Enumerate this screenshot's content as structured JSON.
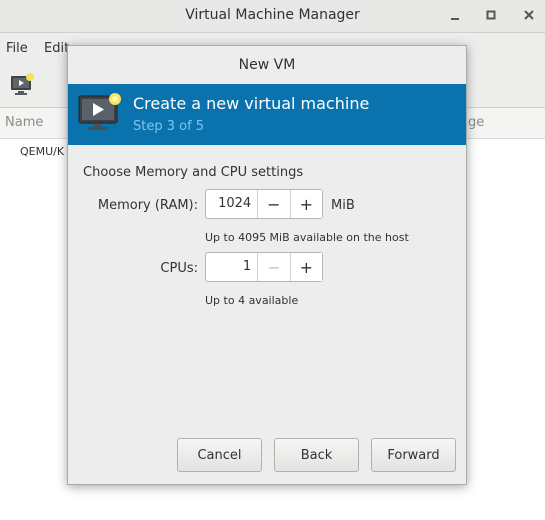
{
  "window": {
    "title": "Virtual Machine Manager",
    "controls": {
      "minimize": "_",
      "maximize": "□",
      "close": "×"
    }
  },
  "menubar": {
    "items": [
      "File",
      "Edit"
    ]
  },
  "list": {
    "headers": {
      "name": "Name",
      "usage": "ge"
    },
    "connection": "QEMU/K"
  },
  "dialog": {
    "title": "New VM",
    "banner": {
      "title": "Create a new virtual machine",
      "step": "Step 3 of 5",
      "icon": "monitor-play-icon"
    },
    "section": "Choose Memory and CPU settings",
    "memory": {
      "label": "Memory (RAM):",
      "value": "1024",
      "unit": "MiB",
      "hint": "Up to 4095 MiB available on the host",
      "minus": "−",
      "plus": "+"
    },
    "cpus": {
      "label": "CPUs:",
      "value": "1",
      "hint": "Up to 4 available",
      "minus": "−",
      "plus": "+"
    },
    "buttons": {
      "cancel": "Cancel",
      "back": "Back",
      "forward": "Forward"
    }
  },
  "colors": {
    "banner": "#0a73ad",
    "banner_step": "#7fc4ec"
  }
}
